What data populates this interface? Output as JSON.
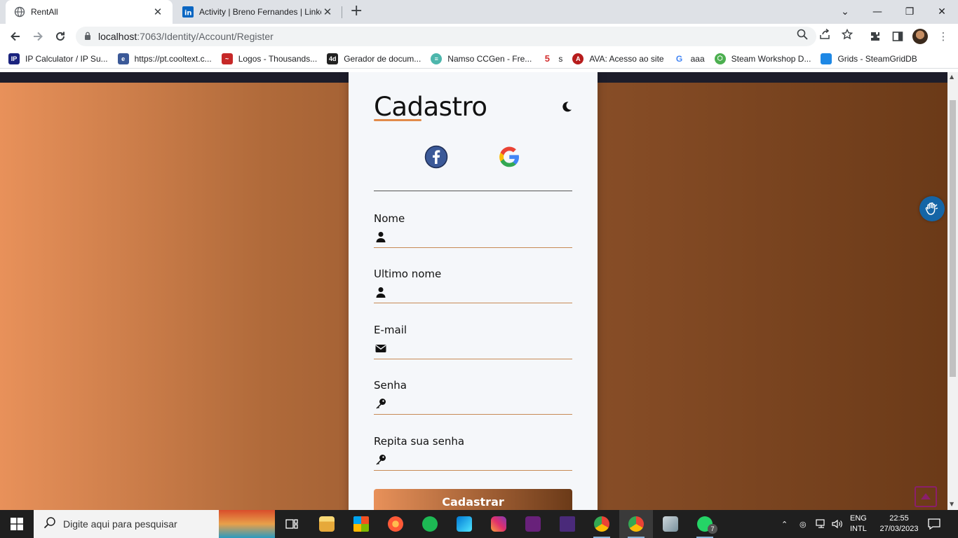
{
  "browser": {
    "tabs": [
      {
        "title": "RentAll",
        "active": true
      },
      {
        "title": "Activity | Breno Fernandes | LinkedIn",
        "active": false
      }
    ],
    "url_host": "localhost",
    "url_path": ":7063/Identity/Account/Register",
    "bookmarks": [
      {
        "label": "IP Calculator / IP Su...",
        "icon": "ip-icon",
        "color": "#1a237e"
      },
      {
        "label": "https://pt.cooltext.c...",
        "icon": "cooltext-icon",
        "color": "#3b5998"
      },
      {
        "label": "Logos - Thousands...",
        "icon": "chili-icon",
        "color": "#c62828"
      },
      {
        "label": "Gerador de docum...",
        "icon": "4devs-icon",
        "color": "#222222"
      },
      {
        "label": "Namso CCGen - Fre...",
        "icon": "namso-icon",
        "color": "#4db6ac"
      },
      {
        "label": "s",
        "icon": "s-icon",
        "color": "#d32f2f"
      },
      {
        "label": "AVA: Acesso ao site",
        "icon": "ava-icon",
        "color": "#b71c1c"
      },
      {
        "label": "aaa",
        "icon": "google-icon",
        "color": "#4285f4"
      },
      {
        "label": "Steam Workshop D...",
        "icon": "steam-icon",
        "color": "#4caf50"
      },
      {
        "label": "Grids - SteamGridDB",
        "icon": "folder-icon",
        "color": "#1e88e5"
      }
    ]
  },
  "form": {
    "title": "Cadastro",
    "fields": [
      {
        "label": "Nome",
        "icon": "user-icon",
        "value": ""
      },
      {
        "label": "Ultimo nome",
        "icon": "user-icon",
        "value": ""
      },
      {
        "label": "E-mail",
        "icon": "envelope-icon",
        "value": ""
      },
      {
        "label": "Senha",
        "icon": "key-icon",
        "value": ""
      },
      {
        "label": "Repita sua senha",
        "icon": "key-icon",
        "value": ""
      }
    ],
    "submit_label": "Cadastrar"
  },
  "colors": {
    "accent": "#e28b4a",
    "gradient_start": "#e8915a",
    "gradient_end": "#6b3a18"
  },
  "taskbar": {
    "search_placeholder": "Digite aqui para pesquisar",
    "lang_line1": "ENG",
    "lang_line2": "INTL",
    "time": "22:55",
    "date": "27/03/2023",
    "whatsapp_badge": "7"
  }
}
